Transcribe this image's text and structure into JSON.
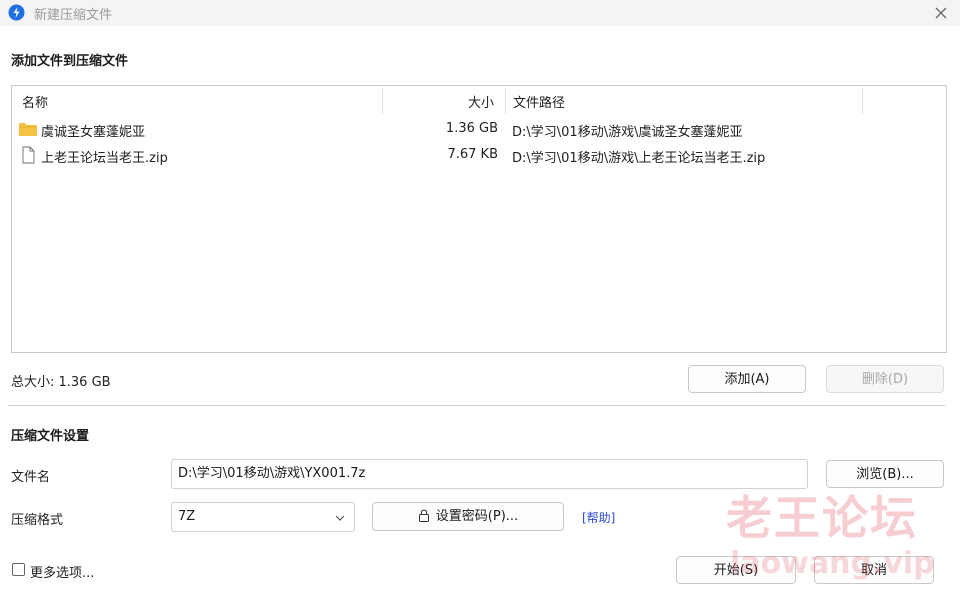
{
  "window": {
    "title": "新建压缩文件"
  },
  "files_section": {
    "title": "添加文件到压缩文件",
    "columns": {
      "name": "名称",
      "size": "大小",
      "path": "文件路径"
    },
    "rows": [
      {
        "icon": "folder-icon",
        "name": "虞诚圣女塞蓬妮亚",
        "size": "1.36 GB",
        "path": "D:\\学习\\01移动\\游戏\\虞诚圣女塞蓬妮亚"
      },
      {
        "icon": "file-icon",
        "name": "上老王论坛当老王.zip",
        "size": "7.67 KB",
        "path": "D:\\学习\\01移动\\游戏\\上老王论坛当老王.zip"
      }
    ],
    "total_size": "总大小: 1.36 GB",
    "add_button": "添加(A)",
    "delete_button": "删除(D)"
  },
  "settings_section": {
    "title": "压缩文件设置",
    "filename_label": "文件名",
    "filename_value": "D:\\学习\\01移动\\游戏\\YX001.7z",
    "browse_button": "浏览(B)...",
    "format_label": "压缩格式",
    "format_value": "7Z",
    "password_button": "设置密码(P)...",
    "help_link": "[帮助]"
  },
  "footer": {
    "more_options": "更多选项...",
    "start_button": "开始(S)",
    "cancel_button": "取消"
  },
  "watermark": {
    "cn": "老王论坛",
    "en": "laowang.vip"
  },
  "colors": {
    "folder": "#f5c243",
    "app_icon": "#1f6fe0",
    "link": "#2b4bd6"
  }
}
